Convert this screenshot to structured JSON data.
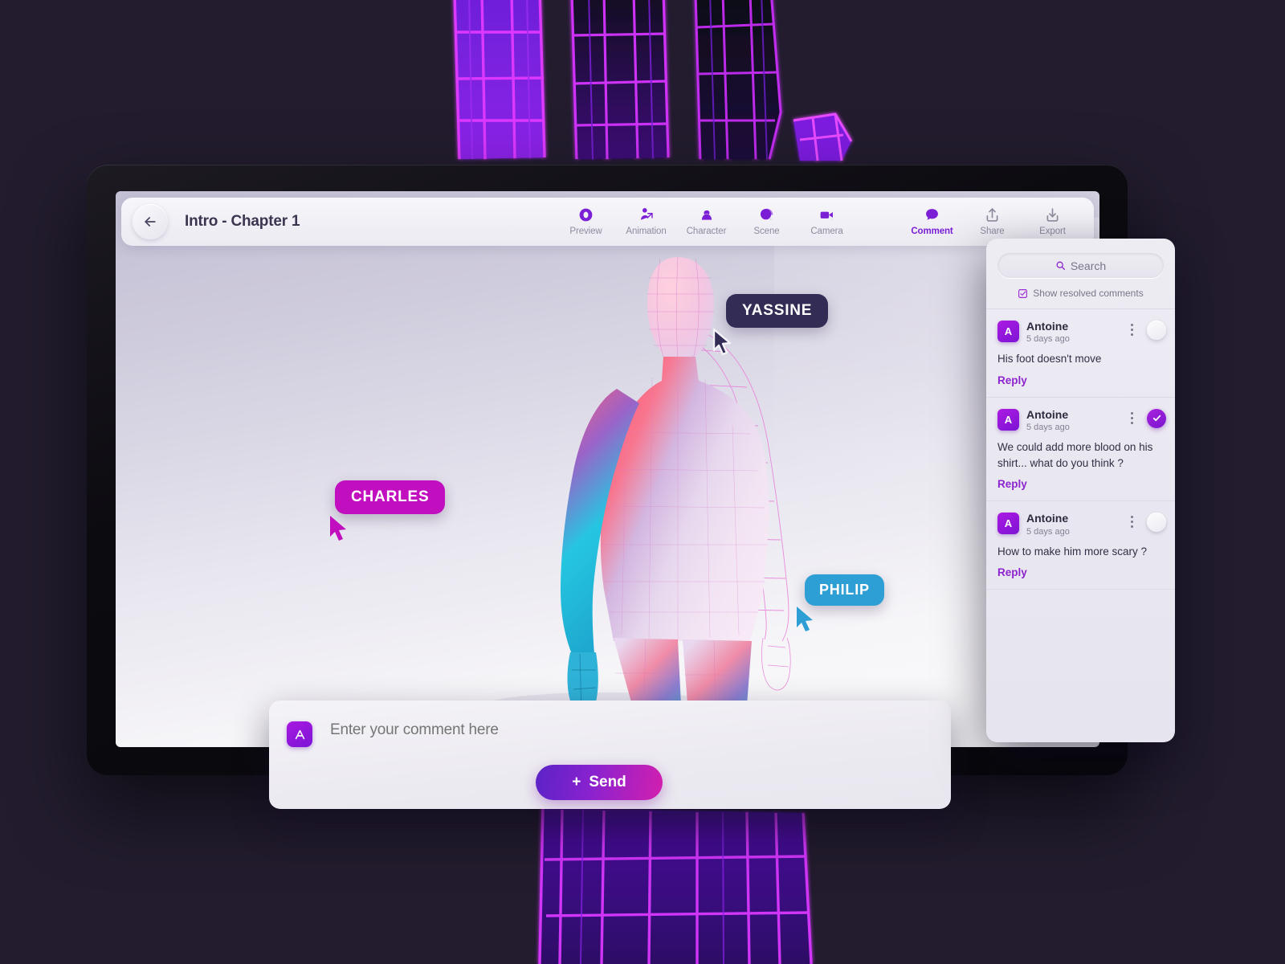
{
  "theme": {
    "background": "#221c2e",
    "accent_purple": "#7b1fd6",
    "accent_magenta": "#c10fbf",
    "accent_blue": "#2e9fd4",
    "bezel": "#0c0b10"
  },
  "topbar": {
    "back_icon": "arrow-left-icon",
    "title": "Intro - Chapter 1",
    "tools_left": [
      {
        "label": "Preview",
        "icon": "preview-eye-icon",
        "active": false
      },
      {
        "label": "Animation",
        "icon": "animation-person-icon",
        "active": false
      },
      {
        "label": "Character",
        "icon": "character-bust-icon",
        "active": false
      },
      {
        "label": "Scene",
        "icon": "scene-sphere-icon",
        "active": false
      },
      {
        "label": "Camera",
        "icon": "camera-video-icon",
        "active": false
      }
    ],
    "tools_right": [
      {
        "label": "Comment",
        "icon": "comment-bubble-icon",
        "active": true
      },
      {
        "label": "Share",
        "icon": "share-upload-icon",
        "active": false
      },
      {
        "label": "Export",
        "icon": "export-download-icon",
        "active": false
      }
    ]
  },
  "viewport": {
    "model_name": "humanoid-character-wireframe",
    "collaborators": [
      {
        "name": "YASSINE",
        "color": "#332d55",
        "cursor": "pointer-cursor-icon"
      },
      {
        "name": "CHARLES",
        "color": "#c10fbf",
        "cursor": "pointer-cursor-icon"
      },
      {
        "name": "PHILIP",
        "color": "#2e9fd4",
        "cursor": "pointer-cursor-icon"
      }
    ]
  },
  "composer": {
    "avatar_initial": "A",
    "placeholder": "Enter your comment here",
    "value": "",
    "send_label": "Send",
    "send_plus": "+"
  },
  "panel": {
    "search": {
      "placeholder": "Search",
      "icon": "search-icon",
      "value": ""
    },
    "show_resolved": {
      "label": "Show resolved comments",
      "icon": "checkbox-check-icon",
      "checked": true
    },
    "comments": [
      {
        "avatar_initial": "A",
        "author": "Antoine",
        "time": "5 days ago",
        "text": "His foot doesn't move",
        "reply_label": "Reply",
        "resolved": false
      },
      {
        "avatar_initial": "A",
        "author": "Antoine",
        "time": "5 days ago",
        "text": "We could add more blood on his shirt... what do you think ?",
        "reply_label": "Reply",
        "resolved": true
      },
      {
        "avatar_initial": "A",
        "author": "Antoine",
        "time": "5 days ago",
        "text": "How to make him more scary ?",
        "reply_label": "Reply",
        "resolved": false
      }
    ]
  }
}
